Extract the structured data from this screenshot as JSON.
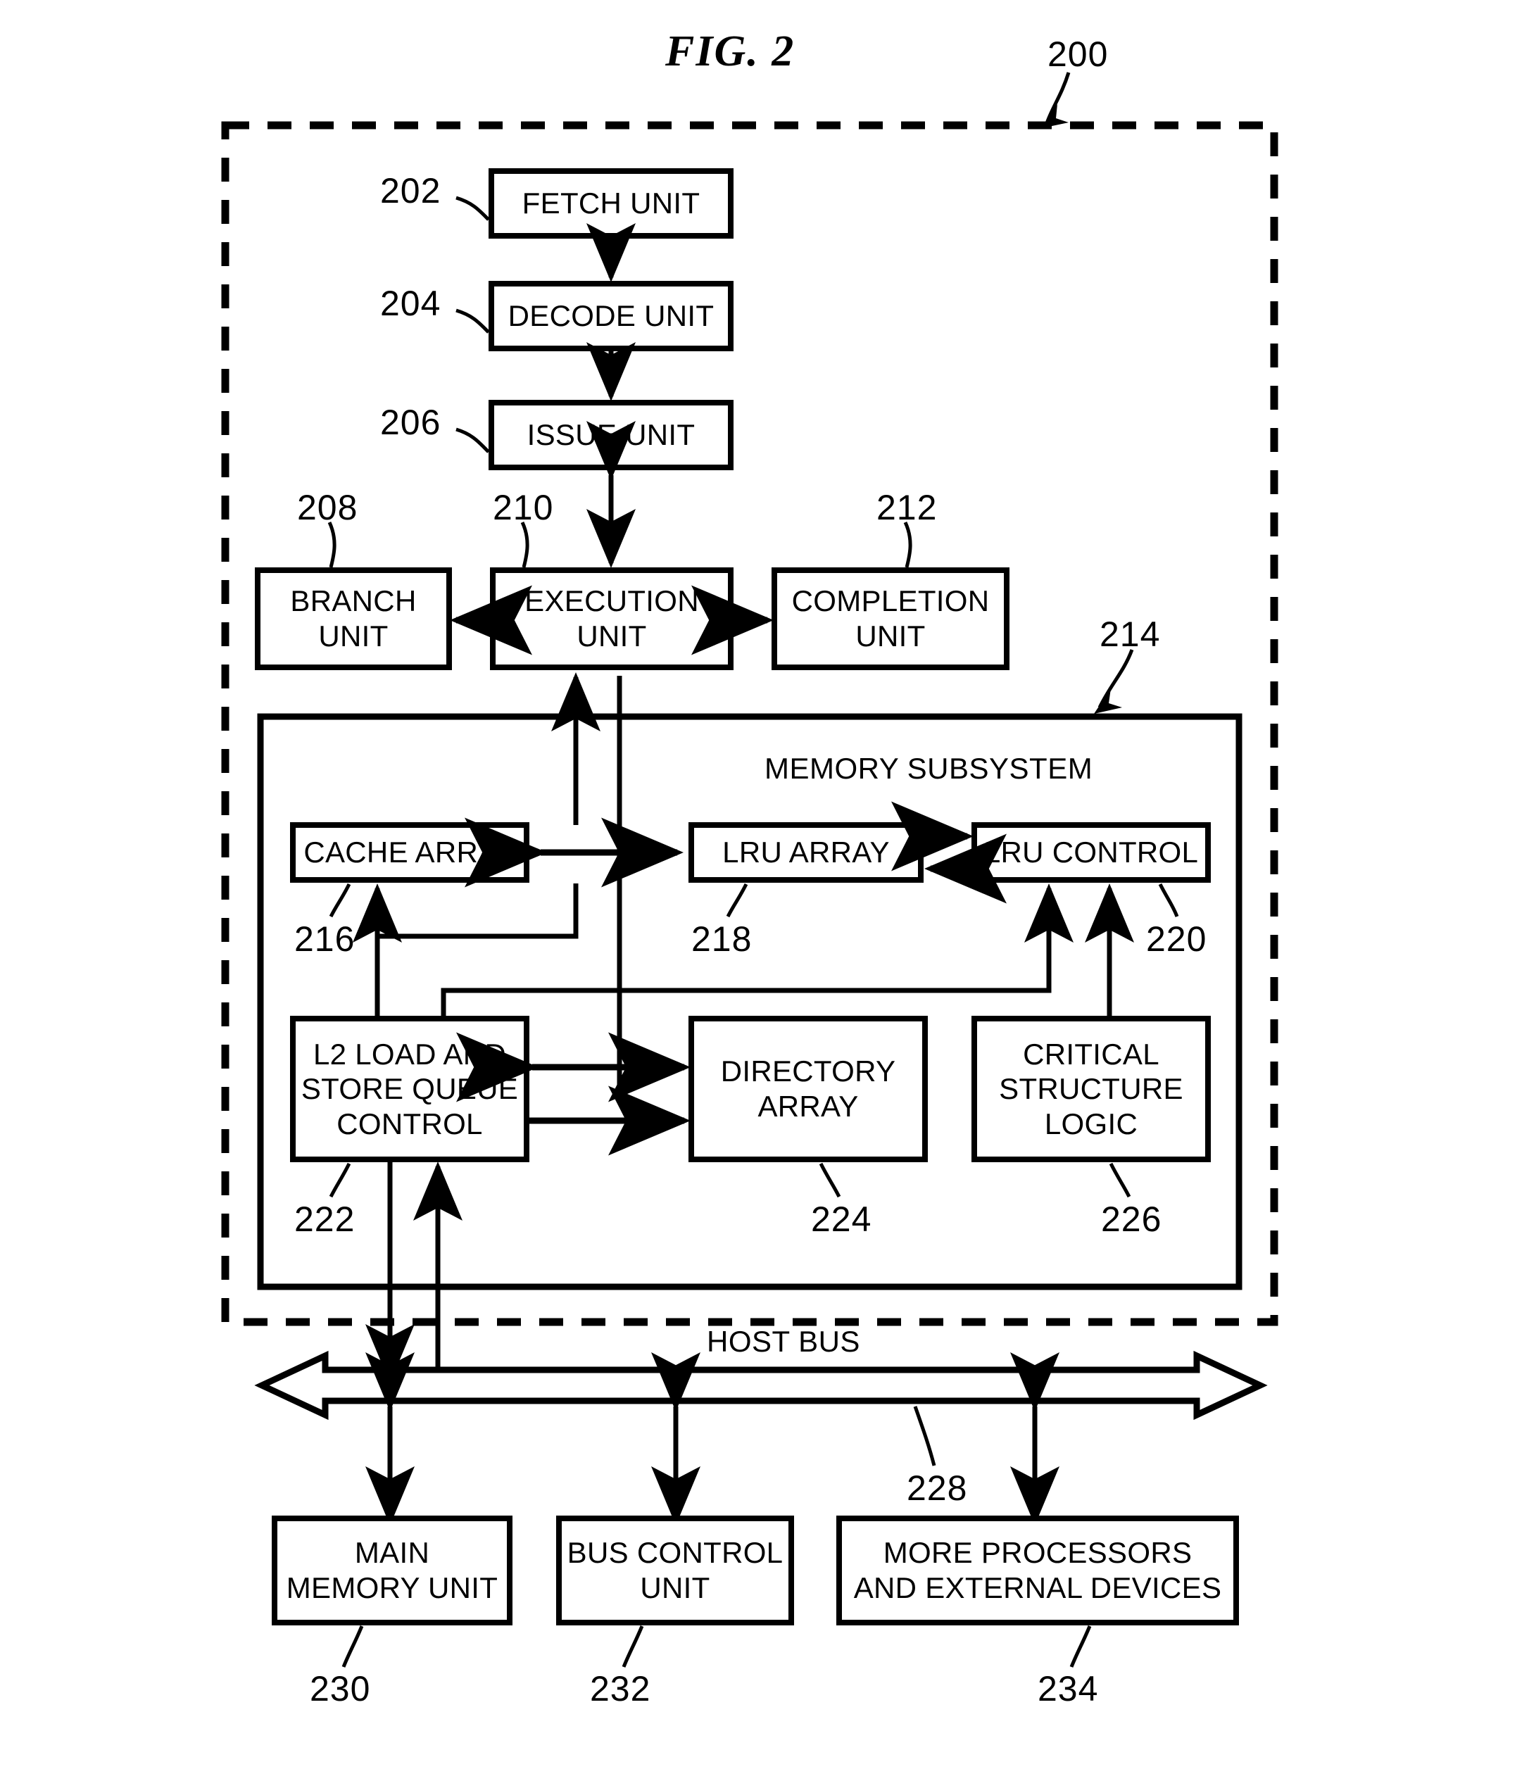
{
  "figure": {
    "title": "FIG. 2",
    "system_ref": "200"
  },
  "boxes": [
    {
      "id": "fetch-unit",
      "label": "FETCH UNIT",
      "ref": "202"
    },
    {
      "id": "decode-unit",
      "label": "DECODE UNIT",
      "ref": "204"
    },
    {
      "id": "issue-unit",
      "label": "ISSUE UNIT",
      "ref": "206"
    },
    {
      "id": "branch-unit",
      "label": "BRANCH\nUNIT",
      "ref": "208"
    },
    {
      "id": "execution-unit",
      "label": "EXECUTION\nUNIT",
      "ref": "210"
    },
    {
      "id": "completion-unit",
      "label": "COMPLETION\nUNIT",
      "ref": "212"
    },
    {
      "id": "memory-subsystem",
      "label": "MEMORY SUBSYSTEM",
      "ref": "214"
    },
    {
      "id": "cache-array",
      "label": "CACHE ARRAY",
      "ref": "216"
    },
    {
      "id": "lru-array",
      "label": "LRU ARRAY",
      "ref": "218"
    },
    {
      "id": "lru-control",
      "label": "LRU CONTROL",
      "ref": "220"
    },
    {
      "id": "l2-load-store",
      "label": "L2 LOAD AND\nSTORE QUEUE\nCONTROL",
      "ref": "222"
    },
    {
      "id": "directory-array",
      "label": "DIRECTORY\nARRAY",
      "ref": "224"
    },
    {
      "id": "critical-structure",
      "label": "CRITICAL\nSTRUCTURE\nLOGIC",
      "ref": "226"
    },
    {
      "id": "host-bus",
      "label": "HOST BUS",
      "ref": "228"
    },
    {
      "id": "main-memory-unit",
      "label": "MAIN\nMEMORY UNIT",
      "ref": "230"
    },
    {
      "id": "bus-control-unit",
      "label": "BUS CONTROL\nUNIT",
      "ref": "232"
    },
    {
      "id": "more-processors",
      "label": "MORE PROCESSORS\nAND EXTERNAL DEVICES",
      "ref": "234"
    }
  ],
  "labels": {
    "fetch_unit": "FETCH UNIT",
    "decode_unit": "DECODE UNIT",
    "issue_unit": "ISSUE UNIT",
    "branch_unit": "BRANCH\nUNIT",
    "execution_unit": "EXECUTION\nUNIT",
    "completion_unit": "COMPLETION\nUNIT",
    "memory_subsystem": "MEMORY SUBSYSTEM",
    "cache_array": "CACHE ARRAY",
    "lru_array": "LRU ARRAY",
    "lru_control": "LRU CONTROL",
    "l2_load_store": "L2 LOAD AND\nSTORE QUEUE\nCONTROL",
    "directory_array": "DIRECTORY\nARRAY",
    "critical_structure": "CRITICAL\nSTRUCTURE\nLOGIC",
    "host_bus": "HOST BUS",
    "main_memory_unit": "MAIN\nMEMORY UNIT",
    "bus_control_unit": "BUS CONTROL\nUNIT",
    "more_processors": "MORE PROCESSORS\nAND EXTERNAL DEVICES"
  },
  "refs": {
    "r200": "200",
    "r202": "202",
    "r204": "204",
    "r206": "206",
    "r208": "208",
    "r210": "210",
    "r212": "212",
    "r214": "214",
    "r216": "216",
    "r218": "218",
    "r220": "220",
    "r222": "222",
    "r224": "224",
    "r226": "226",
    "r228": "228",
    "r230": "230",
    "r232": "232",
    "r234": "234"
  },
  "colors": {
    "stroke": "#000000",
    "background": "#ffffff"
  }
}
